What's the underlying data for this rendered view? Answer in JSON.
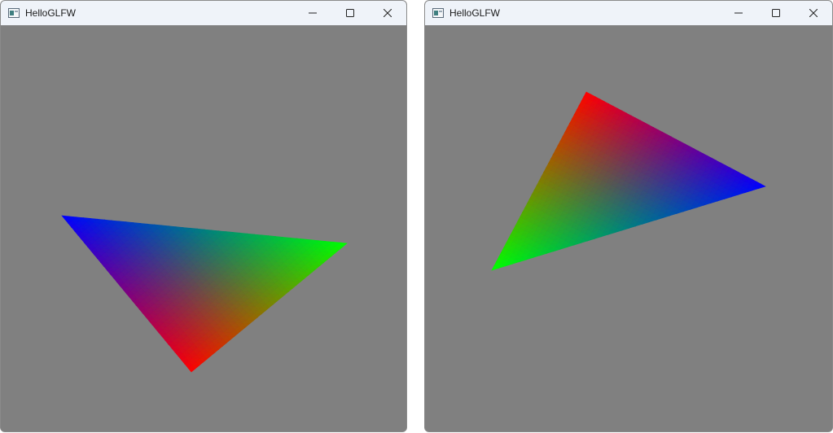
{
  "windows": [
    {
      "title": "HelloGLFW",
      "icon": "app-window-icon",
      "background": "#808080",
      "triangle_colors": [
        "#0000ff",
        "#00ff00",
        "#ff0000"
      ]
    },
    {
      "title": "HelloGLFW",
      "icon": "app-window-icon",
      "background": "#808080",
      "triangle_colors": [
        "#ff0000",
        "#0000ff",
        "#00ff00"
      ]
    }
  ],
  "caption_buttons": {
    "minimize": "minimize-icon",
    "maximize": "maximize-icon",
    "close": "close-icon"
  }
}
